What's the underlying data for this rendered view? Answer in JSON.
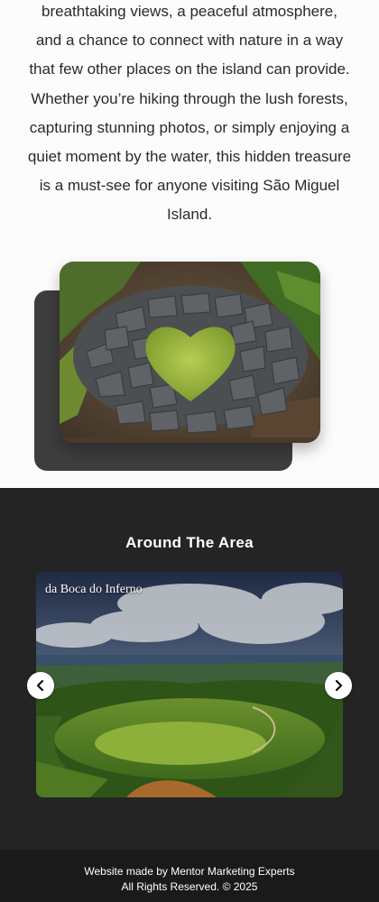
{
  "intro": {
    "lines": [
      "breathtaking views, a peaceful atmosphere,",
      "and a chance to connect with nature in a way",
      "that few other places on the island can provide.",
      "Whether you’re hiking through the lush forests,",
      "capturing stunning photos, or simply enjoying a",
      "quiet moment by the water, this hidden treasure",
      "is a must-see for anyone visiting São Miguel",
      "Island."
    ]
  },
  "around": {
    "title": "Around The Area",
    "slide_caption": "da Boca do Inferno",
    "prev_icon": "chevron-left-icon",
    "next_icon": "chevron-right-icon"
  },
  "footer": {
    "line1": "Website made by Mentor Marketing Experts",
    "line2": "All Rights Reserved. © 2025"
  },
  "colors": {
    "intro_bg": "#fcfcfc",
    "section_bg": "#242424",
    "footer_bg": "#1a1a1a",
    "text_dark": "#2a2a2a",
    "shadow_card": "#3d3d3d"
  }
}
